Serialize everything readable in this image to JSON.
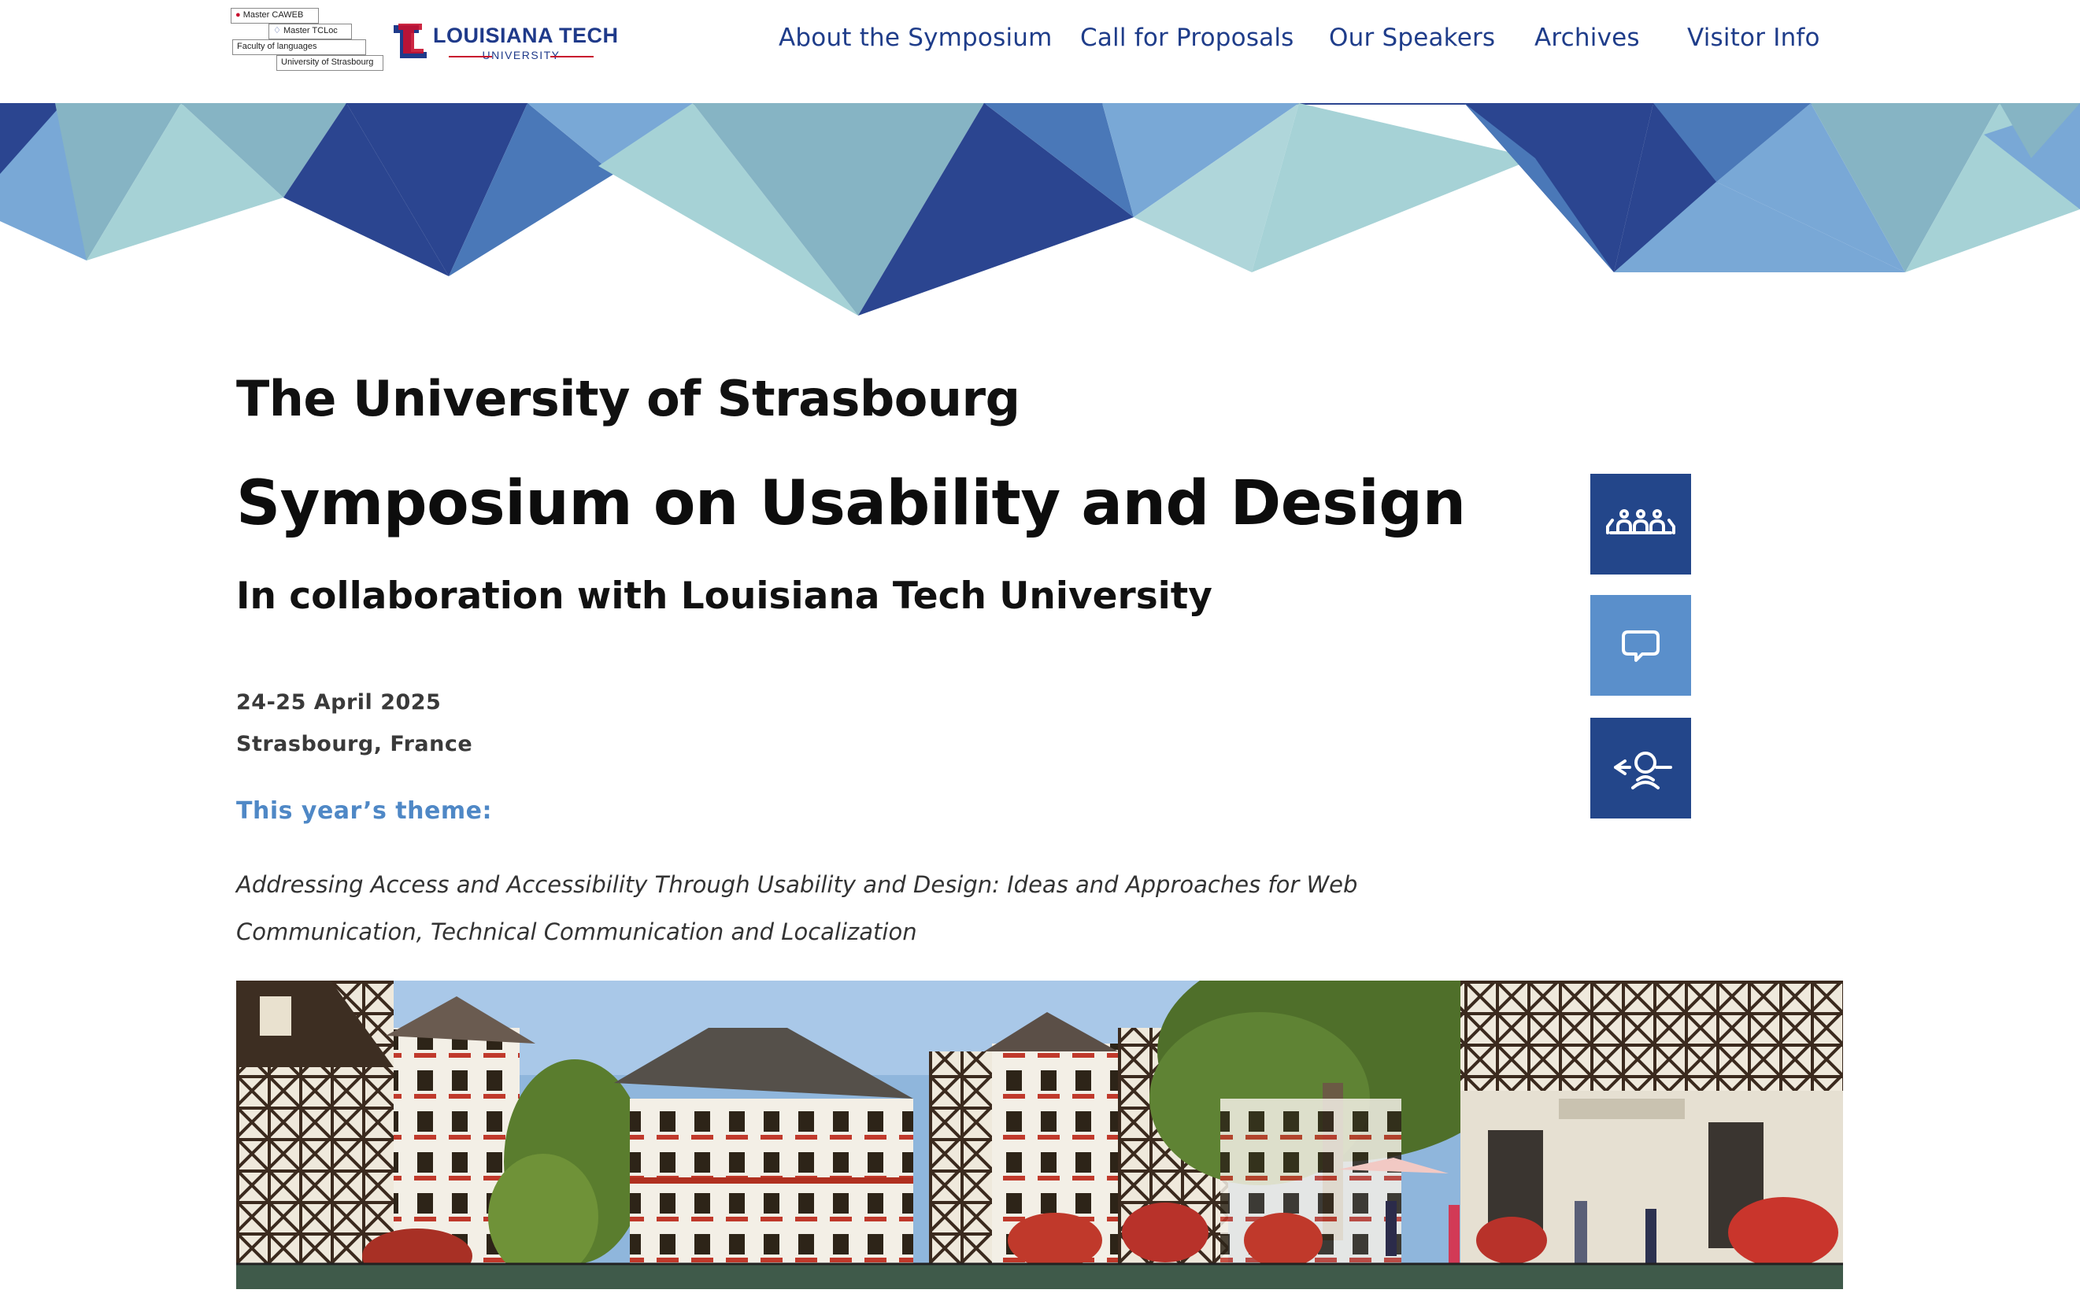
{
  "header": {
    "strasbourg_logo": {
      "lines": [
        "Master CAWEB",
        "Master TCLoc",
        "Faculty of languages",
        "University of Strasbourg"
      ]
    },
    "latech_logo": {
      "name": "LOUISIANA TECH",
      "sub": "UNIVERSITY"
    },
    "nav": [
      {
        "label": "About the Symposium"
      },
      {
        "label": "Call for Proposals"
      },
      {
        "label": "Our Speakers"
      },
      {
        "label": "Archives"
      },
      {
        "label": "Visitor Info"
      }
    ]
  },
  "main": {
    "university": "The University of Strasbourg",
    "title": "Symposium on Usability and Design",
    "collaboration": "In collaboration with Louisiana Tech University",
    "date": "24-25 April 2025",
    "location": "Strasbourg, France",
    "theme_label": "This year’s theme:",
    "theme_text": "Addressing Access and Accessibility Through Usability and Design: Ideas and Approaches for Web Communication, Technical Communication and Localization"
  },
  "side_tiles": [
    {
      "icon": "audience-icon",
      "color": "#23468a"
    },
    {
      "icon": "speech-bubble-icon",
      "color": "#5a8fcb"
    },
    {
      "icon": "speaker-icon",
      "color": "#23468a"
    }
  ],
  "colors": {
    "nav_text": "#1f3d8a",
    "accent_blue": "#4f88c6",
    "dark_blue": "#23468a",
    "latech_red": "#c8102e"
  },
  "banner": {
    "palette": [
      "#2b4590",
      "#4a78b8",
      "#79a8d6",
      "#86b4c4",
      "#a6d2d6"
    ]
  }
}
